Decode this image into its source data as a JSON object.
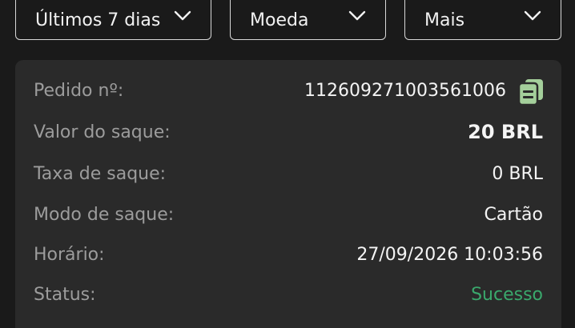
{
  "filters": {
    "period": "Últimos 7 dias",
    "currency": "Moeda",
    "more": "Mais"
  },
  "details": {
    "order_label": "Pedido nº:",
    "order_value": "112609271003561006",
    "amount_label": "Valor do saque:",
    "amount_value": "20 BRL",
    "fee_label": "Taxa de saque:",
    "fee_value": "0 BRL",
    "mode_label": "Modo de saque:",
    "mode_value": "Cartão",
    "time_label": "Horário:",
    "time_value": "27/09/2026 10:03:56",
    "status_label": "Status:",
    "status_value": "Sucesso"
  },
  "colors": {
    "background": "#1a1a1a",
    "card": "#2a2a2a",
    "success": "#3aa86c",
    "copy_icon": "#a4cf9b"
  },
  "icons": {
    "dropdown": "chevron-down-icon",
    "copy": "copy-icon"
  }
}
